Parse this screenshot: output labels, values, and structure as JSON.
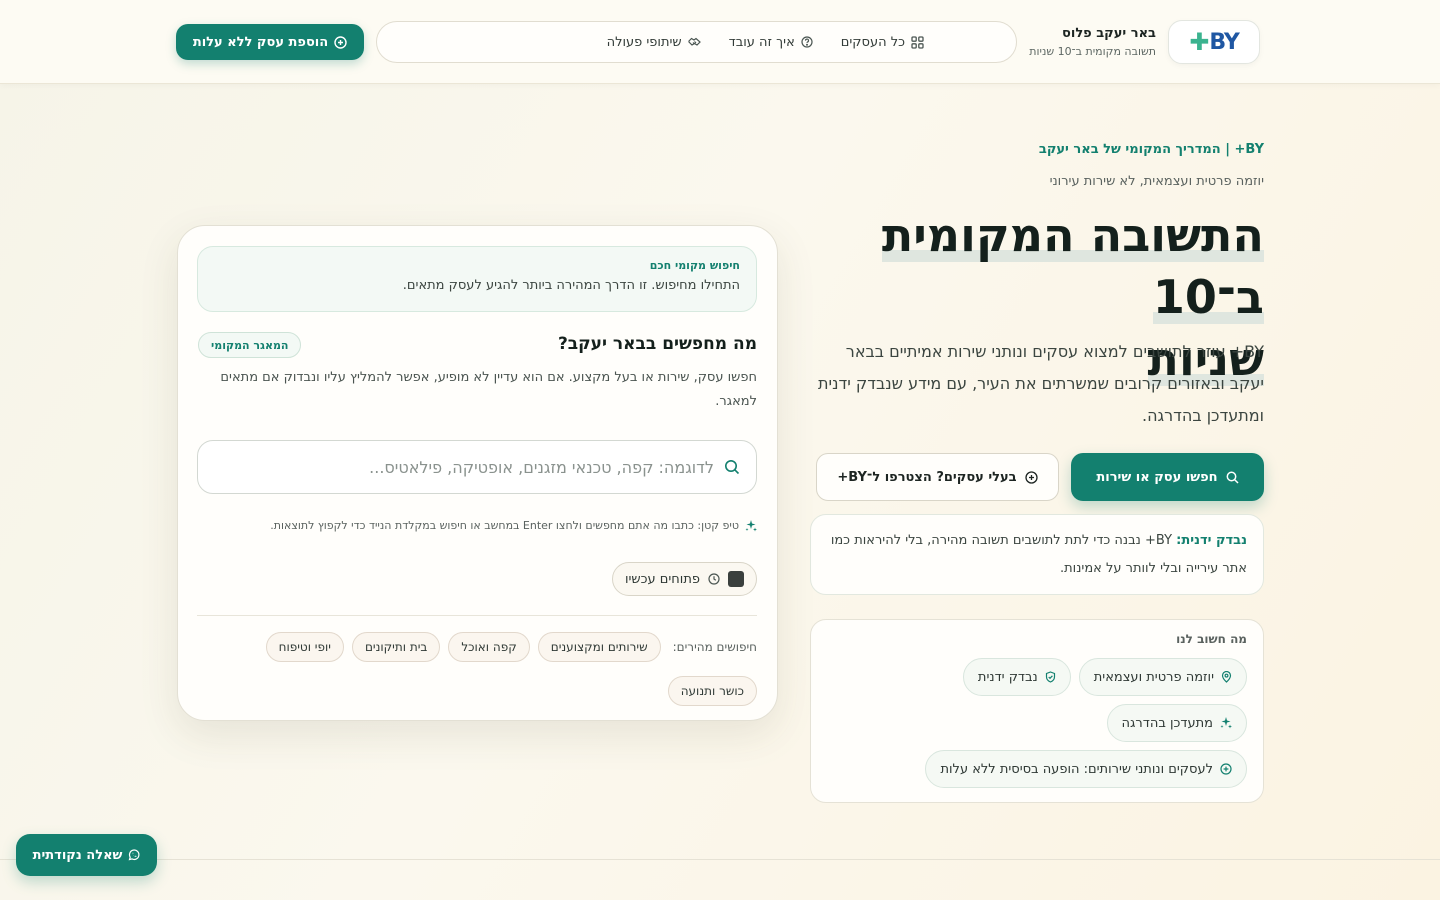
{
  "header": {
    "logo_text": "BY",
    "logo_plus": "✚",
    "brand_name": "באר יעקב פלוס",
    "brand_tagline": "תשובה מקומית ב־10 שניות",
    "nav": [
      {
        "label": "כל העסקים",
        "icon": "grid-icon"
      },
      {
        "label": "איך זה עובד",
        "icon": "help-circle-icon"
      },
      {
        "label": "שיתופי פעולה",
        "icon": "handshake-icon"
      }
    ],
    "add_business_label": "הוספת עסק ללא עלות"
  },
  "hero": {
    "eyebrow": "BY+ | המדריך המקומי של באר יעקב",
    "sub_eyebrow": "יוזמה פרטית ועצמאית, לא שירות עירוני",
    "title_line1": "התשובה המקומית ב־10",
    "title_line2": "שניות",
    "description": "BY+ עוזר לתושבים למצוא עסקים ונותני שירות אמיתיים בבאר יעקב ובאזורים קרובים שמשרתים את העיר, עם מידע שנבדק ידנית ומתעדכן בהדרגה.",
    "search_button": "חפשו עסק או שירות",
    "join_button": "בעלי עסקים? הצטרפו ל־BY+",
    "trust_strong": "נבדק ידנית:",
    "trust_text": " BY+ נבנה כדי לתת לתושבים תשובה מהירה, בלי להיראות כמו אתר עירייה ובלי לוותר על אמינות."
  },
  "values": {
    "title": "מה חשוב לנו",
    "chips": [
      {
        "label": "יוזמה פרטית ועצמאית",
        "icon": "map-pin-icon"
      },
      {
        "label": "נבדק ידנית",
        "icon": "shield-check-icon"
      },
      {
        "label": "מתעדכן בהדרגה",
        "icon": "sparkles-icon"
      },
      {
        "label": "לעסקים ונותני שירותים: הופעה בסיסית ללא עלות",
        "icon": "plus-circle-icon"
      }
    ]
  },
  "search_card": {
    "smart_title": "חיפוש מקומי חכם",
    "smart_desc": "התחילו מחיפוש. זו הדרך המהירה ביותר להגיע לעסק מתאים.",
    "question": "מה מחפשים בבאר יעקב?",
    "badge": "המאגר המקומי",
    "description": "חפשו עסק, שירות או בעל מקצוע. אם הוא עדיין לא מופיע, אפשר להמליץ עליו ונבדוק אם מתאים למאגר.",
    "search_placeholder": "לדוגמה: קפה, טכנאי מזגנים, אופטיקה, פילאטיס...",
    "tip": "טיפ קטן: כתבו מה אתם מחפשים ולחצו Enter במחשב או חיפוש במקלדת הנייד כדי לקפוץ לתוצאות.",
    "open_now": "פתוחים עכשיו",
    "quick_label": "חיפושים מהירים:",
    "quick": [
      "שירותים ומקצוענים",
      "קפה ואוכל",
      "בית ותיקונים",
      "יופי וטיפוח",
      "כושר ותנועה"
    ]
  },
  "whatsapp_label": "שאלה נקודתית",
  "colors": {
    "accent": "#13806f",
    "logo_blue": "#1f57a3",
    "logo_green": "#3bb38f"
  }
}
